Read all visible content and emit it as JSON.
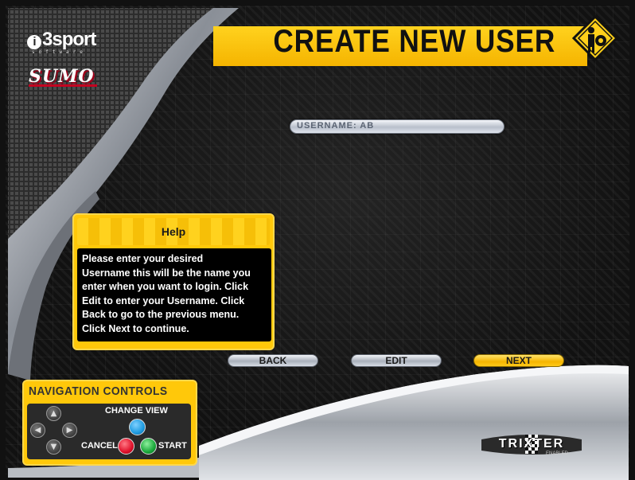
{
  "branding": {
    "i3sport_logo": "i3sport",
    "i3sport_sub": "software",
    "sumo_logo": "SUMO",
    "trixter_logo": "TRIXTER",
    "trixter_sub": "ENABLED"
  },
  "header": {
    "title": "CREATE NEW USER"
  },
  "username_field": {
    "label": "USERNAME:",
    "value": "AB"
  },
  "help": {
    "title": "Help",
    "lines": [
      "Please enter your desired",
      "Username this will be the name you",
      "enter when you want to login. Click",
      "Edit to enter your Username. Click",
      "Back to go to the previous menu.",
      "Click Next to continue."
    ]
  },
  "buttons": {
    "back": "BACK",
    "edit": "EDIT",
    "next": "NEXT"
  },
  "navigation": {
    "title": "NAVIGATION CONTROLS",
    "change_view": "CHANGE VIEW",
    "cancel": "CANCEL",
    "start": "START"
  },
  "colors": {
    "accent_yellow": "#ffc80a",
    "background": "#141414",
    "cancel_button": "#e0102a",
    "start_button": "#1aa83a",
    "change_view_button": "#1e9be0"
  },
  "icons": [
    "user-crossing-sign-icon",
    "up-arrow-icon",
    "down-arrow-icon",
    "left-arrow-icon",
    "right-arrow-icon"
  ]
}
